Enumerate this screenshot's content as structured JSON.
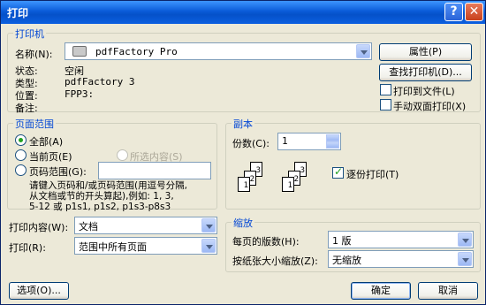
{
  "window": {
    "title": "打印",
    "help": "?",
    "close": "✕"
  },
  "printer": {
    "group_title": "打印机",
    "name_label": "名称(N):",
    "name_value": "pdfFactory Pro",
    "status_label": "状态:",
    "status_value": "空闲",
    "type_label": "类型:",
    "type_value": "pdfFactory 3",
    "location_label": "位置:",
    "location_value": "FPP3:",
    "comment_label": "备注:",
    "properties_btn": "属性(P)",
    "find_btn": "查找打印机(D)...",
    "print_to_file": "打印到文件(L)",
    "manual_duplex": "手动双面打印(X)"
  },
  "page_range": {
    "group_title": "页面范围",
    "all": "全部(A)",
    "current": "当前页(E)",
    "selection": "所选内容(S)",
    "pages": "页码范围(G):",
    "hint_line1": "请键入页码和/或页码范围(用逗号分隔,",
    "hint_line2": "从文档或节的开头算起),例如: 1, 3,",
    "hint_line3": "5-12 或 p1s1, p1s2, p1s3-p8s3"
  },
  "copies": {
    "group_title": "副本",
    "count_label": "份数(C):",
    "count_value": "1",
    "collate": "逐份打印(T)",
    "page_labels": [
      "3",
      "2",
      "1",
      "3",
      "2",
      "1"
    ]
  },
  "print_what": {
    "label": "打印内容(W):",
    "value": "文档"
  },
  "print": {
    "label": "打印(R):",
    "value": "范围中所有页面"
  },
  "zoom": {
    "group_title": "缩放",
    "pages_per_sheet_label": "每页的版数(H):",
    "pages_per_sheet_value": "1 版",
    "scale_label": "按纸张大小缩放(Z):",
    "scale_value": "无缩放"
  },
  "footer": {
    "options": "选项(O)...",
    "ok": "确定",
    "cancel": "取消"
  }
}
